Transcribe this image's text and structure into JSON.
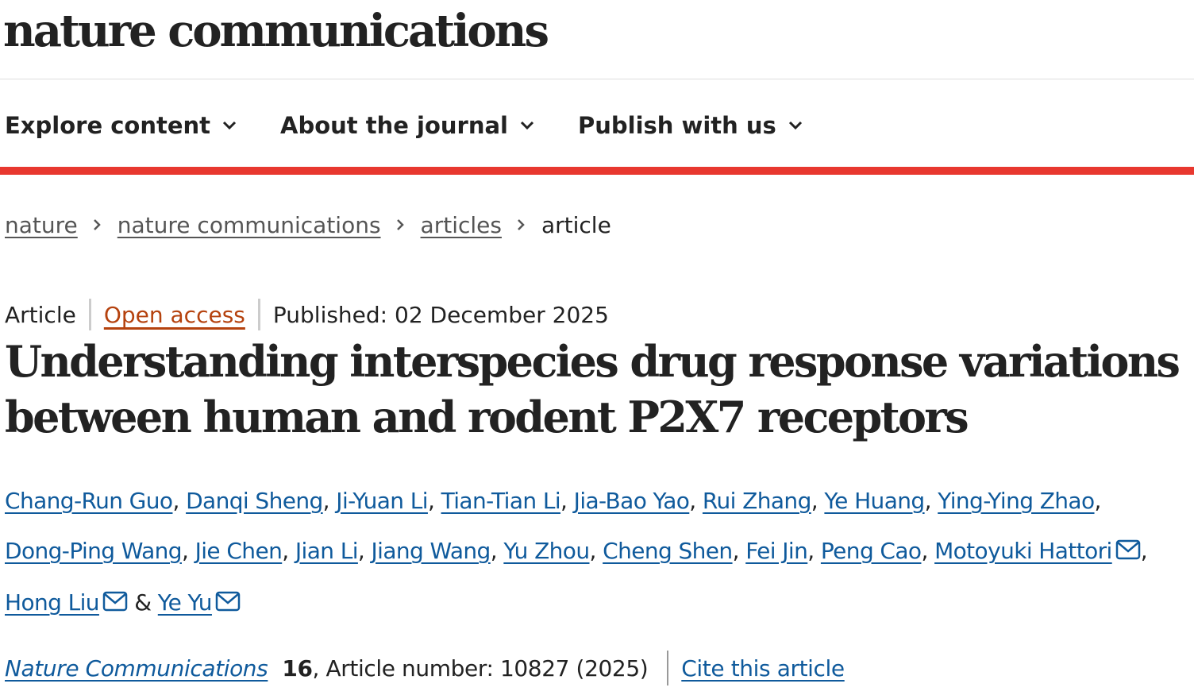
{
  "header": {
    "logo": "nature communications"
  },
  "nav": {
    "items": [
      {
        "label": "Explore content",
        "icon": "chevron-down-icon"
      },
      {
        "label": "About the journal",
        "icon": "chevron-down-icon"
      },
      {
        "label": "Publish with us",
        "icon": "chevron-down-icon"
      }
    ]
  },
  "breadcrumb": {
    "items": [
      "nature",
      "nature communications",
      "articles"
    ],
    "current": "article",
    "separator_icon": "chevron-right-icon"
  },
  "article": {
    "type": "Article",
    "access": "Open access",
    "published": "Published: 02 December 2025",
    "title": "Understanding interspecies drug response variations between human and rodent P2X7 receptors",
    "authors": [
      "Chang-Run Guo",
      "Danqi Sheng",
      "Ji-Yuan Li",
      "Tian-Tian Li",
      "Jia-Bao Yao",
      "Rui Zhang",
      "Ye Huang",
      "Ying-Ying Zhao",
      "Dong-Ping Wang",
      "Jie Chen",
      "Jian Li",
      "Jiang Wang",
      "Yu Zhou",
      "Cheng Shen",
      "Fei Jin",
      "Peng Cao",
      "Motoyuki Hattori",
      "Hong Liu",
      "Ye Yu"
    ],
    "author_separator": ",",
    "author_and": "&",
    "mail_icon": "mail-icon",
    "journal": "Nature Communications",
    "volume": "16",
    "article_number": ", Article number: 10827 (2025)",
    "cite_label": "Cite this article"
  },
  "colors": {
    "accent_red": "#e8382f",
    "link_blue": "#0f5a9c",
    "open_access": "#b5420e"
  }
}
